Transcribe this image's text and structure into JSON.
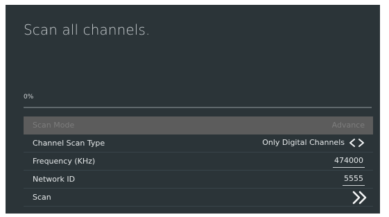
{
  "screen": {
    "title": "Scan all channels.",
    "progress": {
      "label": "0%",
      "value": 0
    }
  },
  "menu": {
    "scan_mode": {
      "label": "Scan Mode",
      "value": "Advance"
    },
    "channel_scan_type": {
      "label": "Channel Scan Type",
      "value": "Only Digital Channels",
      "icons": [
        "left-arrow-icon",
        "right-arrow-icon"
      ]
    },
    "frequency": {
      "label": "Frequency (KHz)",
      "value": "474000"
    },
    "network_id": {
      "label": "Network ID",
      "value": "5555"
    },
    "scan": {
      "label": "Scan",
      "icon": "double-chevron-right-icon"
    }
  },
  "colors": {
    "background": "#2b3438",
    "disabled_row": "#5c5c5c",
    "text": "#e6e9ea",
    "muted_text": "#7d7d7d"
  }
}
